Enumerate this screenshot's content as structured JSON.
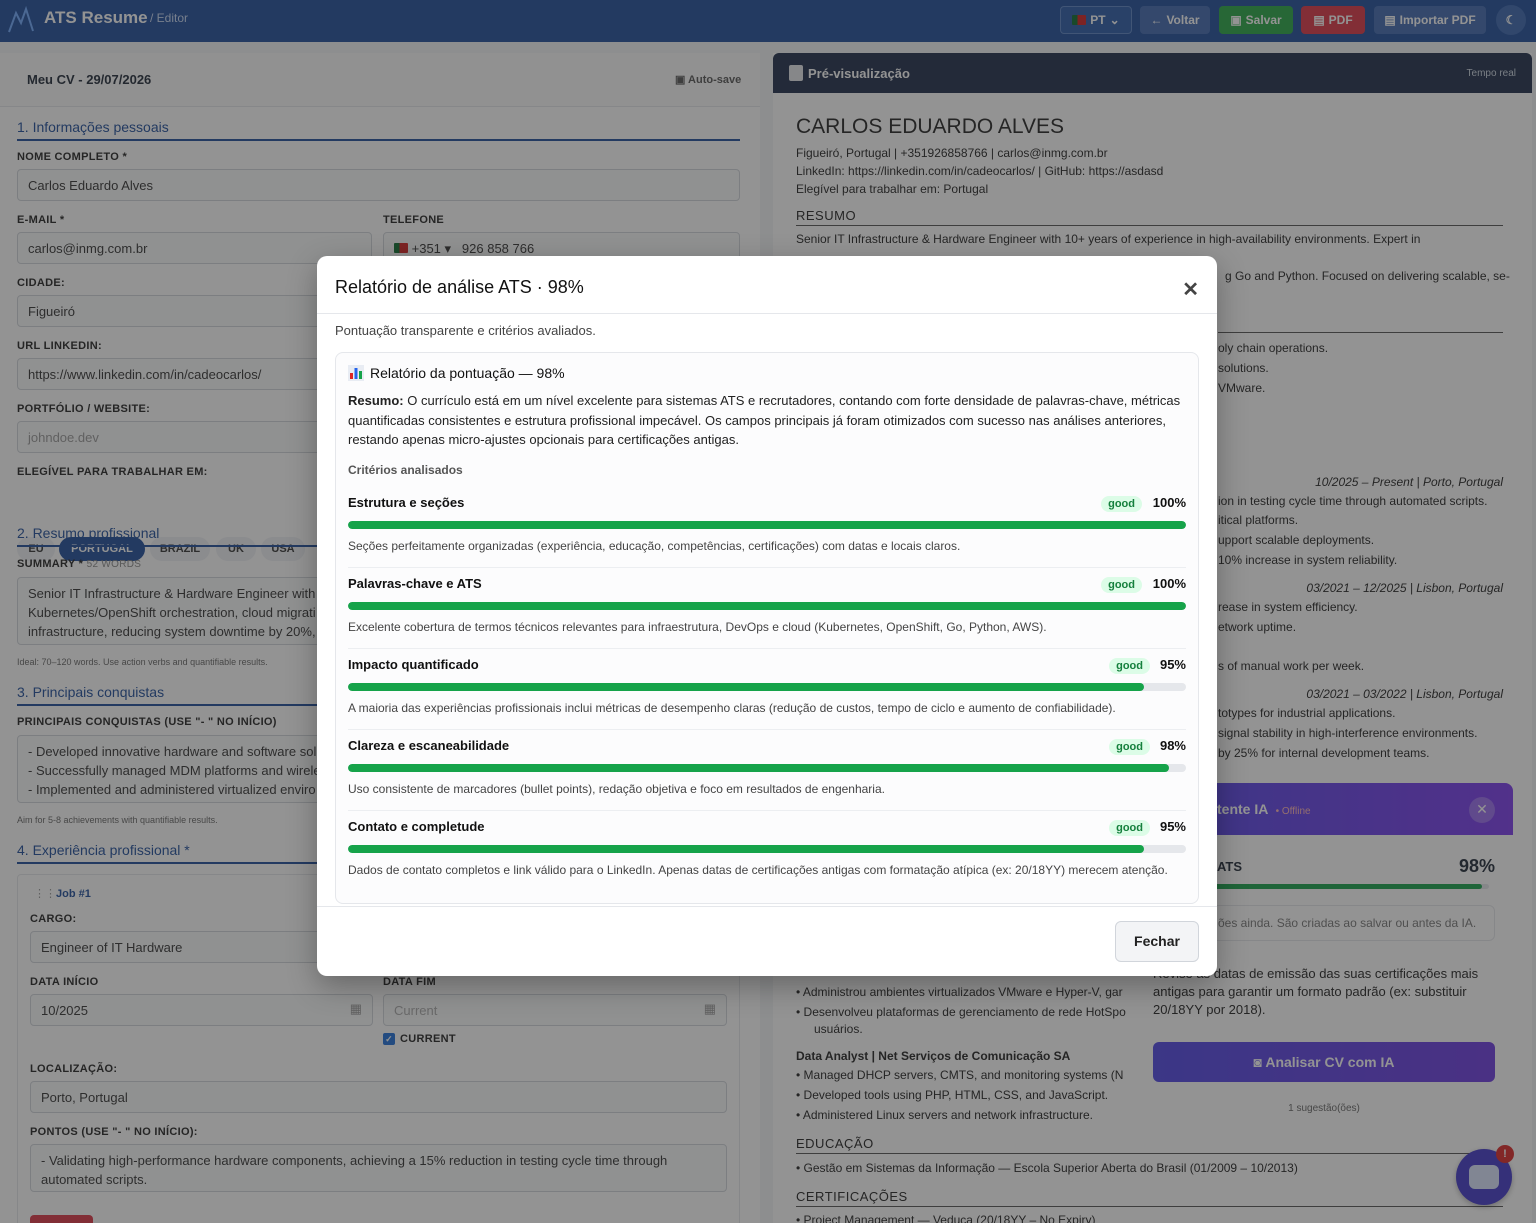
{
  "app": {
    "title": "ATS Resume",
    "subtitle": "/ Editor"
  },
  "toolbar": {
    "lang": "PT",
    "back": "Voltar",
    "save": "Salvar",
    "pdf": "PDF",
    "import": "Importar PDF"
  },
  "editor": {
    "cv_name": "Meu CV - 29/07/2026",
    "autosave": "Auto-save",
    "sec1": "1. Informações pessoais",
    "full_name_label": "NOME COMPLETO *",
    "full_name": "Carlos Eduardo Alves",
    "email_label": "E-MAIL *",
    "email": "carlos@inmg.com.br",
    "phone_label": "TELEFONE",
    "phone_code": "+351",
    "phone": "926 858 766",
    "city_label": "CIDADE:",
    "city": "Figueiró",
    "linkedin_label": "URL LINKEDIN:",
    "linkedin": "https://www.linkedin.com/in/cadeocarlos/",
    "portfolio_label": "PORTFÓLIO / WEBSITE:",
    "portfolio_placeholder": "johndoe.dev",
    "eligible_label": "ELEGÍVEL PARA TRABALHAR EM:",
    "eligible": [
      "EU",
      "PORTUGAL",
      "BRAZIL",
      "UK",
      "USA"
    ],
    "sec2": "2. Resumo profissional",
    "summary_label": "SUMMARY *",
    "summary_words": "52 WORDS",
    "summary_text": "Senior IT Infrastructure & Hardware Engineer with\nKubernetes/OpenShift orchestration, cloud migrati\ninfrastructure, reducing system downtime by 20%,",
    "summary_hint": "Ideal: 70–120 words. Use action verbs and quantifiable results.",
    "sec3": "3. Principais conquistas",
    "ach_label": "PRINCIPAIS CONQUISTAS (USE \"- \" NO INÍCIO)",
    "ach_text": "- Developed innovative hardware and software sol\n- Successfully managed MDM platforms and wirele\n- Implemented and administered virtualized enviro",
    "ach_hint": "Aim for 5-8 achievements with quantifiable results.",
    "sec4": "4. Experiência profissional *",
    "job_tag": "Job #1",
    "cargo_label": "CARGO:",
    "cargo": "Engineer of IT Hardware",
    "start_label": "DATA INÍCIO",
    "start": "10/2025",
    "end_label": "DATA FIM",
    "end_placeholder": "Current",
    "current_label": "CURRENT",
    "loc_label": "LOCALIZAÇÃO:",
    "loc": "Porto, Portugal",
    "points_label": "PONTOS (USE \"- \" NO INÍCIO):",
    "points": "- Validating high-performance hardware components, achieving a 15% reduction in testing cycle time through\nautomated scripts."
  },
  "preview": {
    "title": "Pré-visualização",
    "time": "Tempo real",
    "name": "CARLOS EDUARDO ALVES",
    "line1": "Figueiró, Portugal | +351926858766 | carlos@inmg.com.br",
    "line2": "LinkedIn: https://linkedin.com/in/cadeocarlos/ | GitHub: https://asdasd",
    "line3": "Elegível para trabalhar em: Portugal",
    "resumo_h": "RESUMO",
    "resumo_1": "Senior IT Infrastructure & Hardware Engineer with 10+ years of experience in high-availability environments. Expert in",
    "resumo_3": "g Go and Python. Focused on delivering scalable, se-",
    "r1": "oly chain operations.",
    "r2": "solutions.",
    "r3": "VMware.",
    "r4": "10/2025 – Present | Porto, Portugal",
    "r5": "ion in testing cycle time through automated scripts.",
    "r6": "itical platforms.",
    "r7": "upport scalable deployments.",
    "r8": "10% increase in system reliability.",
    "r9": "03/2021 – 12/2025 | Lisbon, Portugal",
    "r10": "rease in system efficiency.",
    "r11": "etwork uptime.",
    "r12": "s of manual work per week.",
    "r13": "03/2021 – 03/2022 | Lisbon, Portugal",
    "r14": "totypes for industrial applications.",
    "r15": "signal stability in high-interference environments.",
    "r16": "by 25% for internal development teams.",
    "b1": "Administrou ambientes virtualizados VMware e Hyper-V, gar",
    "b2": "Desenvolveu plataformas de gerenciamento de rede HotSpo",
    "b2b": "usuários.",
    "job2": "Data Analyst | Net Serviços de Comunicação SA",
    "j2a": "Managed DHCP servers, CMTS, and monitoring systems (N",
    "j2b": "Developed tools using PHP, HTML, CSS, and JavaScript.",
    "j2c": "Administered Linux servers and network infrastructure.",
    "edu_h": "EDUCAÇÃO",
    "edu1": "Gestão em Sistemas da Informação — Escola Superior Aberta do Brasil (01/2009 – 10/2013)",
    "cert_h": "CERTIFICAÇÕES",
    "cert1": "Project Management — Veduca (20/18YY – No Expiry)"
  },
  "assistant": {
    "title": "tente IA",
    "status": "• Offline",
    "ats_label": "ATS",
    "score": "98%",
    "score_value": 98,
    "info": "ões ainda. São criadas ao salvar ou antes da IA.",
    "suggestion": "Revise as datas de emissão das suas certificações mais antigas para garantir um formato padrão (ex: substituir 20/18YY por 2018).",
    "button": "Analisar CV com IA",
    "count": "1 sugestão(ões)",
    "badge": "!"
  },
  "modal": {
    "title": "Relatório de análise ATS · 98%",
    "subtitle": "Pontuação transparente e critérios avaliados.",
    "card_title": "Relatório da pontuação — 98%",
    "summary_label": "Resumo:",
    "summary": " O currículo está em um nível excelente para sistemas ATS e recrutadores, contando com forte densidade de palavras-chave, métricas quantificadas consistentes e estrutura profissional impecável. Os campos principais já foram otimizados com sucesso nas análises anteriores, restando apenas micro-ajustes opcionais para certificações antigas.",
    "criteria_label": "Critérios analisados",
    "criteria": [
      {
        "name": "Estrutura e seções",
        "status": "good",
        "pct": "100%",
        "value": 100,
        "desc": "Seções perfeitamente organizadas (experiência, educação, competências, certificações) com datas e locais claros."
      },
      {
        "name": "Palavras-chave e ATS",
        "status": "good",
        "pct": "100%",
        "value": 100,
        "desc": "Excelente cobertura de termos técnicos relevantes para infraestrutura, DevOps e cloud (Kubernetes, OpenShift, Go, Python, AWS)."
      },
      {
        "name": "Impacto quantificado",
        "status": "good",
        "pct": "95%",
        "value": 95,
        "desc": "A maioria das experiências profissionais inclui métricas de desempenho claras (redução de custos, tempo de ciclo e aumento de confiabilidade)."
      },
      {
        "name": "Clareza e escaneabilidade",
        "status": "good",
        "pct": "98%",
        "value": 98,
        "desc": "Uso consistente de marcadores (bullet points), redação objetiva e foco em resultados de engenharia."
      },
      {
        "name": "Contato e completude",
        "status": "good",
        "pct": "95%",
        "value": 95,
        "desc": "Dados de contato completos e link válido para o LinkedIn. Apenas datas de certificações antigas com formatação atípica (ex: 20/18YY) merecem atenção."
      }
    ],
    "close_button": "Fechar"
  },
  "colors": {
    "primary": "#1e4d9a",
    "success": "#16a34a",
    "danger": "#dc3545",
    "assistant": "#4f46e5"
  }
}
